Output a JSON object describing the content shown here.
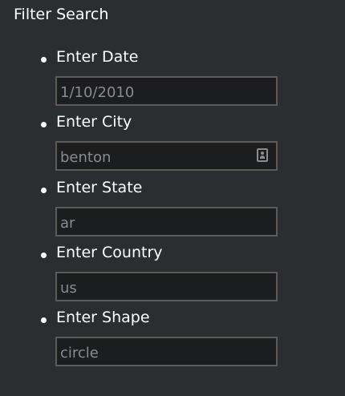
{
  "panel": {
    "title": "Filter Search"
  },
  "fields": [
    {
      "label": "Enter Date",
      "value": "1/10/2010"
    },
    {
      "label": "Enter City",
      "value": "benton",
      "icon": "contact-card-icon"
    },
    {
      "label": "Enter State",
      "value": "ar"
    },
    {
      "label": "Enter Country",
      "value": "us"
    },
    {
      "label": "Enter Shape",
      "value": "circle"
    }
  ],
  "colors": {
    "background": "#2b2e31",
    "input_background": "#1c1d1f",
    "input_border": "#5e5a55",
    "input_text": "#8b8b8b",
    "label_text": "#ffffff"
  }
}
